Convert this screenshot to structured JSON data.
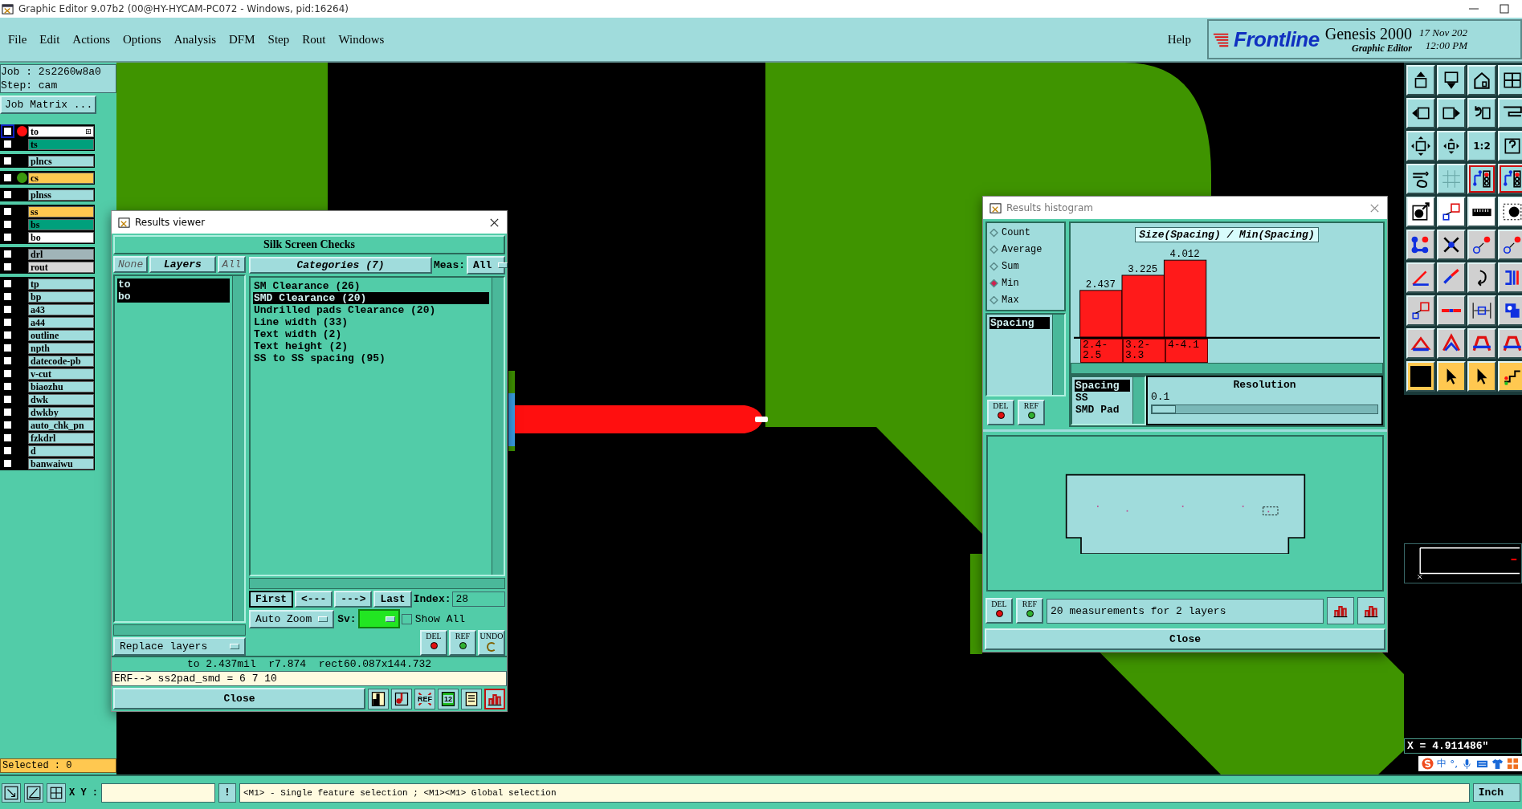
{
  "window": {
    "title": "Graphic Editor 9.07b2 (00@HY-HYCAM-PC072 - Windows, pid:16264)"
  },
  "menu": [
    "File",
    "Edit",
    "Actions",
    "Options",
    "Analysis",
    "DFM",
    "Step",
    "Rout",
    "Windows"
  ],
  "help": "Help",
  "brand": {
    "logo": "Frontline",
    "product": "Genesis 2000",
    "subtitle": "Graphic Editor",
    "date": "17 Nov 202",
    "time": "12:00 PM"
  },
  "job": {
    "job": "Job : 2s2260w8a0",
    "step": "Step: cam",
    "matrix_button": "Job Matrix ..."
  },
  "layer_groups": [
    [
      {
        "name": "to",
        "color": "#ffffff",
        "checked": false,
        "focused": true,
        "marker": {
          "color": "#ff1010"
        }
      },
      {
        "name": "ts",
        "color": "#00a07c",
        "checked": false,
        "focused": false
      }
    ],
    [
      {
        "name": "plncs",
        "color": "#a0dcdc",
        "checked": false,
        "focused": false
      }
    ],
    [
      {
        "name": "cs",
        "color": "#ffc850",
        "checked": false,
        "focused": false,
        "marker": {
          "color": "#3c9a10"
        }
      }
    ],
    [
      {
        "name": "plnss",
        "color": "#a0dcdc",
        "checked": false,
        "focused": false
      }
    ],
    [
      {
        "name": "ss",
        "color": "#ffc850",
        "checked": false,
        "focused": false
      },
      {
        "name": "bs",
        "color": "#00a07c",
        "checked": false,
        "focused": false
      },
      {
        "name": "bo",
        "color": "#ffffff",
        "checked": false,
        "focused": false
      }
    ],
    [
      {
        "name": "drl",
        "color": "#a0b4b8",
        "checked": false,
        "focused": false
      },
      {
        "name": "rout",
        "color": "#d8d8d8",
        "checked": false,
        "focused": false
      }
    ],
    [
      {
        "name": "tp",
        "color": "#a0dcdc",
        "checked": false,
        "focused": false
      },
      {
        "name": "bp",
        "color": "#a0dcdc",
        "checked": false,
        "focused": false
      },
      {
        "name": "a43",
        "color": "#a0dcdc",
        "checked": false,
        "focused": false
      },
      {
        "name": "a44",
        "color": "#a0dcdc",
        "checked": false,
        "focused": false
      },
      {
        "name": "outline",
        "color": "#a0dcdc",
        "checked": false,
        "focused": false
      },
      {
        "name": "npth",
        "color": "#a0dcdc",
        "checked": false,
        "focused": false
      },
      {
        "name": "datecode-pb",
        "color": "#a0dcdc",
        "checked": false,
        "focused": false
      },
      {
        "name": "v-cut",
        "color": "#a0dcdc",
        "checked": false,
        "focused": false
      },
      {
        "name": "biaozhu",
        "color": "#a0dcdc",
        "checked": false,
        "focused": false
      },
      {
        "name": "dwk",
        "color": "#a0dcdc",
        "checked": false,
        "focused": false
      },
      {
        "name": "dwkby",
        "color": "#a0dcdc",
        "checked": false,
        "focused": false
      },
      {
        "name": "auto_chk_pn",
        "color": "#a0dcdc",
        "checked": false,
        "focused": false
      },
      {
        "name": "fzkdrl",
        "color": "#a0dcdc",
        "checked": false,
        "focused": false
      },
      {
        "name": "d",
        "color": "#a0dcdc",
        "checked": false,
        "focused": false
      },
      {
        "name": "banwaiwu",
        "color": "#a0dcdc",
        "checked": false,
        "focused": false
      }
    ]
  ],
  "selected_count": "Selected : 0",
  "results_viewer": {
    "title": "Results viewer",
    "heading": "Silk Screen Checks",
    "layer_buttons": [
      {
        "label": "None",
        "kind": "action"
      },
      {
        "label": "Layers",
        "kind": "header"
      },
      {
        "label": "All",
        "kind": "action"
      }
    ],
    "layers": [
      {
        "name": "to",
        "selected": true
      },
      {
        "name": "bo",
        "selected": true
      }
    ],
    "categories_label": "Categories (7)",
    "meas_label": "Meas:",
    "meas_value": "All",
    "categories": [
      {
        "name": "SM Clearance (26)",
        "selected": false
      },
      {
        "name": "SMD Clearance (20)",
        "selected": true
      },
      {
        "name": "Undrilled pads Clearance (20)",
        "selected": false
      },
      {
        "name": "Line width (33)",
        "selected": false
      },
      {
        "name": "Text width (2)",
        "selected": false
      },
      {
        "name": "Text height (2)",
        "selected": false
      },
      {
        "name": "SS to SS spacing (95)",
        "selected": false
      }
    ],
    "nav": [
      {
        "label": "First",
        "selected": true
      },
      {
        "label": "<---",
        "selected": false
      },
      {
        "label": "--->",
        "selected": false
      },
      {
        "label": "Last",
        "selected": false
      }
    ],
    "index_label": "Index:",
    "index_value": "28",
    "zoom_mode": "Auto Zoom",
    "sv": {
      "label": "Sv:",
      "color": "#22e622"
    },
    "show_all": {
      "label": "Show All",
      "checked": false
    },
    "edit_buttons": [
      {
        "kind": "del",
        "label": "DEL"
      },
      {
        "kind": "ref",
        "label": "REF"
      },
      {
        "kind": "undo",
        "label": "UNDO"
      }
    ],
    "replace_mode": "Replace layers",
    "measurement": "to 2.437mil  r7.874  rect60.087x144.732",
    "erf": "ERF--> ss2pad_smd = 6 7 10",
    "close": "Close",
    "tools": [
      {
        "kind": "figure"
      },
      {
        "kind": "marker"
      },
      {
        "kind": "crossed",
        "label": "REF"
      },
      {
        "kind": "counter",
        "label": "12"
      },
      {
        "kind": "report"
      },
      {
        "kind": "histogram"
      }
    ]
  },
  "results_histogram": {
    "title": "Results histogram",
    "modes": [
      {
        "label": "Count",
        "selected": false
      },
      {
        "label": "Average",
        "selected": false
      },
      {
        "label": "Sum",
        "selected": false
      },
      {
        "label": "Min",
        "selected": true
      },
      {
        "label": "Max",
        "selected": false
      }
    ],
    "measures": [
      {
        "name": "Spacing",
        "selected": true
      }
    ],
    "list_buttons": [
      {
        "kind": "del",
        "label": "DEL"
      },
      {
        "kind": "ref",
        "label": "REF"
      }
    ],
    "chart_data": {
      "type": "bar",
      "title": "Size(Spacing) / Min(Spacing)",
      "categories": [
        "2.4-2.5",
        "3.2-3.3",
        "4-4.1"
      ],
      "values": [
        2.437,
        3.225,
        4.012
      ],
      "data_labels": true
    },
    "groups": [
      {
        "name": "Spacing",
        "selected": true
      },
      {
        "name": "SS",
        "selected": false
      },
      {
        "name": "SMD Pad",
        "selected": false
      }
    ],
    "resolution": {
      "label": "Resolution",
      "value": "0.1",
      "level": 0
    },
    "bottom_buttons": [
      {
        "kind": "del",
        "label": "DEL"
      },
      {
        "kind": "ref",
        "label": "REF"
      }
    ],
    "summary": "20 measurements for 2 layers",
    "close": "Close"
  },
  "toolbar": [
    {
      "kind": "box-up",
      "on": false
    },
    {
      "kind": "box-down",
      "on": false
    },
    {
      "kind": "house",
      "on": false
    },
    {
      "kind": "window",
      "on": false
    },
    {
      "kind": "box-left",
      "on": false
    },
    {
      "kind": "box-right",
      "on": false
    },
    {
      "kind": "undo",
      "on": false
    },
    {
      "kind": "bracket",
      "on": false
    },
    {
      "kind": "expand",
      "on": false
    },
    {
      "kind": "compass",
      "on": false
    },
    {
      "kind": "ratio",
      "label": "1:2",
      "on": false
    },
    {
      "kind": "help",
      "on": false
    },
    {
      "kind": "tools",
      "on": false
    },
    {
      "kind": "grid",
      "on": false
    },
    {
      "kind": "circuit",
      "on": true
    },
    {
      "kind": "circuit",
      "on": true
    },
    {
      "kind": "dot",
      "on": false
    },
    {
      "kind": "squares",
      "on": false
    },
    {
      "kind": "ruler",
      "on": false
    },
    {
      "kind": "dashed",
      "on": false
    },
    {
      "kind": "nodes",
      "on": false
    },
    {
      "kind": "cross",
      "on": false
    },
    {
      "kind": "ring",
      "on": false
    },
    {
      "kind": "ring",
      "on": false
    },
    {
      "kind": "angle",
      "on": false
    },
    {
      "kind": "diagonal",
      "on": false
    },
    {
      "kind": "curve",
      "on": false
    },
    {
      "kind": "split",
      "on": false
    },
    {
      "kind": "squares",
      "on": false
    },
    {
      "kind": "line",
      "on": false
    },
    {
      "kind": "dimension",
      "on": false
    },
    {
      "kind": "blob",
      "on": false
    },
    {
      "kind": "triangle",
      "on": false
    },
    {
      "kind": "peak",
      "on": false
    },
    {
      "kind": "arch",
      "on": false
    },
    {
      "kind": "arch",
      "on": false
    },
    {
      "kind": "pointer",
      "on": true
    },
    {
      "kind": "pointer",
      "on": false
    },
    {
      "kind": "pointer",
      "on": false
    },
    {
      "kind": "steps",
      "on": false
    }
  ],
  "coordinates": {
    "x": "X = 4.911486\""
  },
  "status": {
    "xy_label": "X Y :",
    "hint_button": "!",
    "message": "<M1> - Single feature selection ; <M1><M1> Global selection",
    "units": "Inch"
  },
  "ime": {
    "language": "中",
    "punct": "°,"
  }
}
